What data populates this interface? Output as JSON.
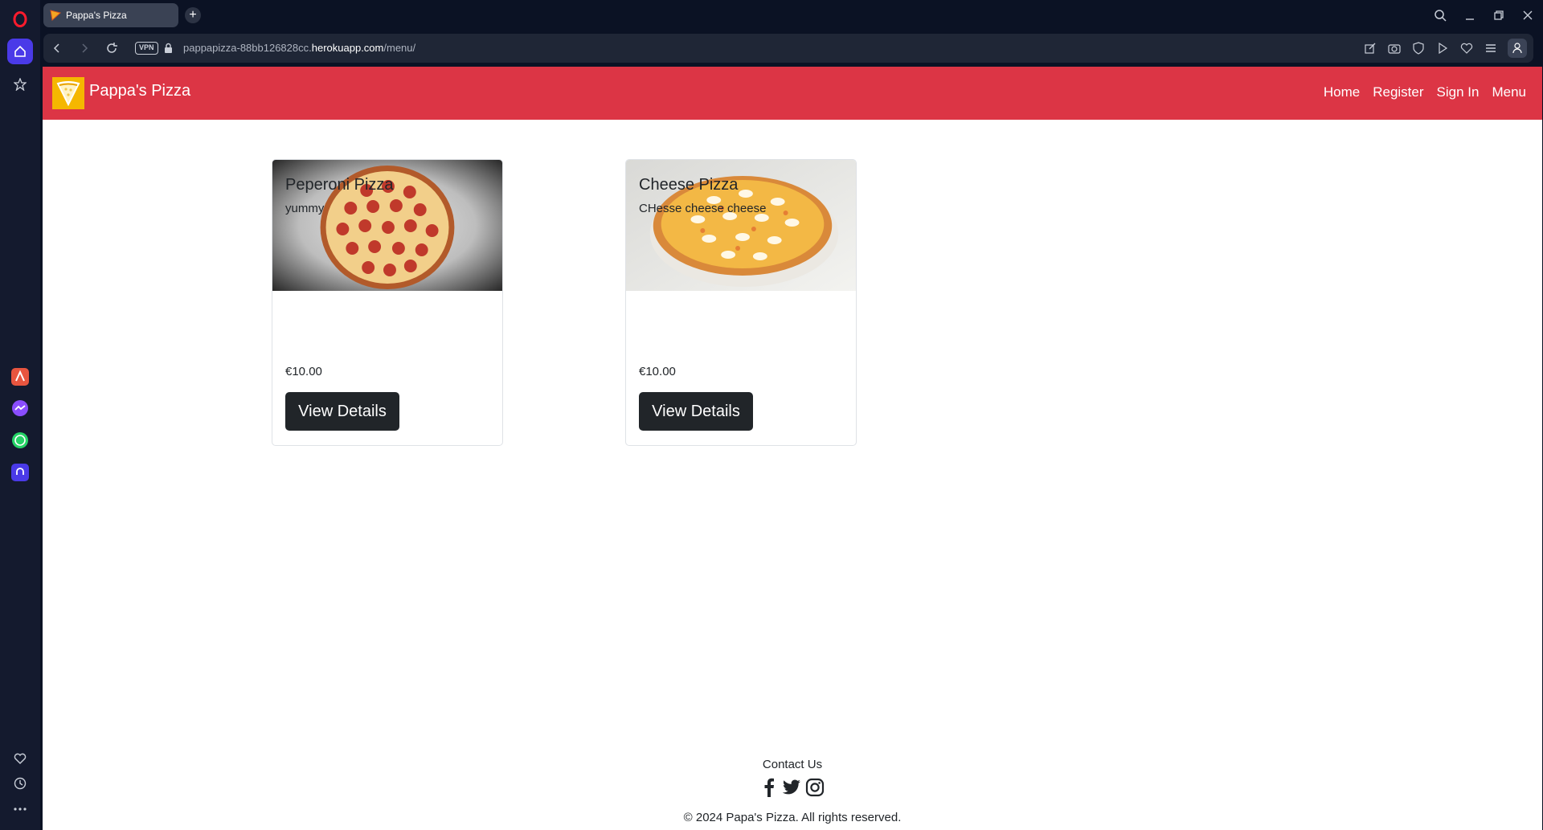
{
  "browser": {
    "tab_title": "Pappa's Pizza",
    "url_prefix": "pappapizza-88bb126828cc.",
    "url_host": "herokuapp.com",
    "url_path": "/menu/",
    "vpn_label": "VPN"
  },
  "navbar": {
    "brand": "Pappa's Pizza",
    "links": [
      "Home",
      "Register",
      "Sign In",
      "Menu"
    ]
  },
  "menu": {
    "items": [
      {
        "name": "Peperoni Pizza",
        "description": "yummy",
        "price": "€10.00",
        "button": "View Details"
      },
      {
        "name": "Cheese Pizza",
        "description": "CHesse cheese cheese",
        "price": "€10.00",
        "button": "View Details"
      }
    ]
  },
  "footer": {
    "contact": "Contact Us",
    "copyright": "© 2024 Papa's Pizza. All rights reserved."
  },
  "colors": {
    "navbar": "#dc3545",
    "button": "#212529",
    "logo": "#f5b700"
  }
}
